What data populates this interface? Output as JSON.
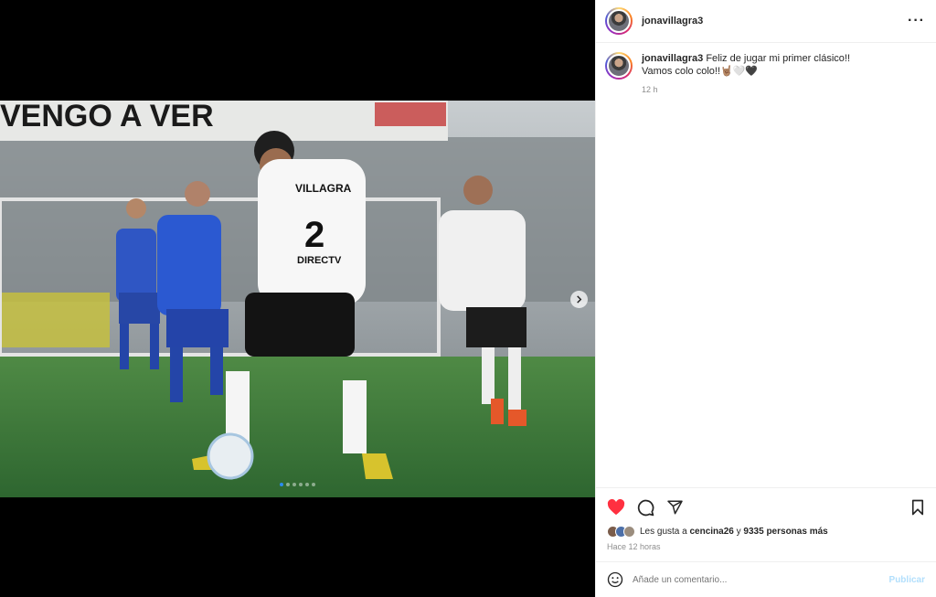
{
  "post": {
    "username": "jonavillagra3",
    "caption_text": "Feliz de jugar mi primer clásico!!",
    "caption_line2": "Vamos colo colo!!🤘🏽🤍🖤",
    "caption_time": "12 h",
    "banner_text": "VENGO A VER",
    "jersey_name": "VILLAGRA",
    "jersey_number": "2",
    "sponsor": "DIRECTV"
  },
  "carousel": {
    "total": 6,
    "active_index": 0
  },
  "icons": {
    "like": "heart-icon-filled",
    "comment": "comment-icon",
    "share": "share-icon",
    "save": "bookmark-icon",
    "more": "more-options-icon",
    "emoji": "emoji-icon",
    "next": "chevron-right-icon"
  },
  "likes": {
    "prefix": "Les gusta a ",
    "user": "cencina26",
    "connector": " y ",
    "others": "9335 personas más"
  },
  "post_time": "Hace 12 horas",
  "comment": {
    "placeholder": "Añade un comentario...",
    "publish_label": "Publicar"
  },
  "colors": {
    "like_red": "#ff3040",
    "publish_disabled": "#b2dffc",
    "carousel_active": "#2a8cf0"
  }
}
